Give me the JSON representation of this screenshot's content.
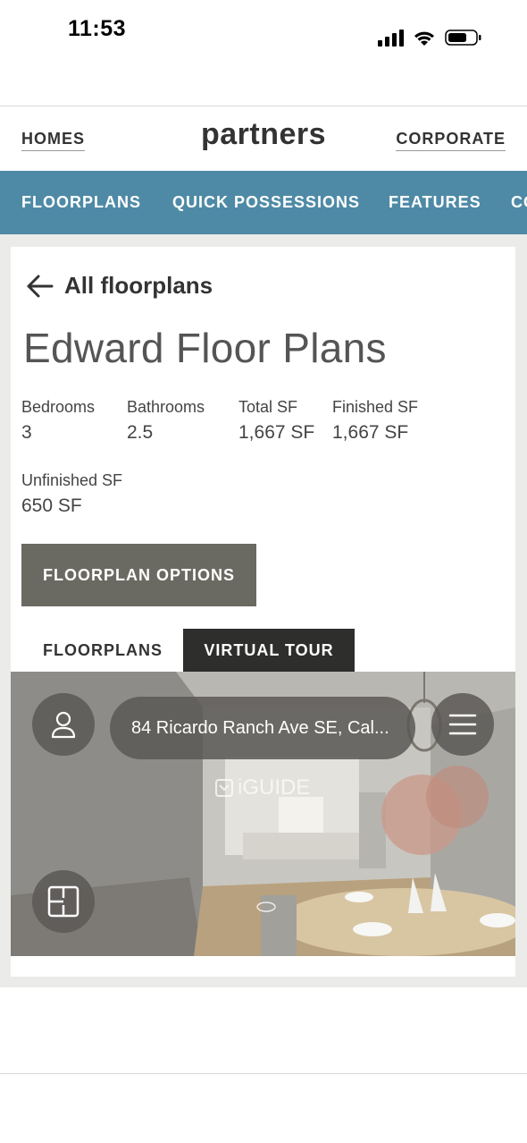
{
  "status_bar": {
    "time": "11:53"
  },
  "top_nav": {
    "homes_label": "HOMES",
    "brand": "partners",
    "corporate_label": "CORPORATE"
  },
  "tabs": [
    {
      "label": "FLOORPLANS"
    },
    {
      "label": "QUICK POSSESSIONS"
    },
    {
      "label": "FEATURES"
    },
    {
      "label": "CO"
    }
  ],
  "back_link": {
    "label": "All floorplans",
    "icon": "arrow-left-icon"
  },
  "title": "Edward Floor Plans",
  "specs": [
    {
      "label": "Bedrooms",
      "value": "3"
    },
    {
      "label": "Bathrooms",
      "value": "2.5"
    },
    {
      "label": "Total SF",
      "value": "1,667 SF"
    },
    {
      "label": "Finished SF",
      "value": "1,667 SF"
    },
    {
      "label": "Unfinished SF",
      "value": "650 SF"
    }
  ],
  "options_button": "FLOORPLAN OPTIONS",
  "view_tabs": [
    {
      "label": "FLOORPLANS",
      "active": false
    },
    {
      "label": "VIRTUAL TOUR",
      "active": true
    }
  ],
  "viewer": {
    "address": "84 Ricardo Ranch Ave SE, Cal...",
    "watermark": "iGUIDE"
  },
  "colors": {
    "tab_bar": "#4e8aa6",
    "options_button": "#6b6a62",
    "active_tab": "#2e2e2c"
  }
}
